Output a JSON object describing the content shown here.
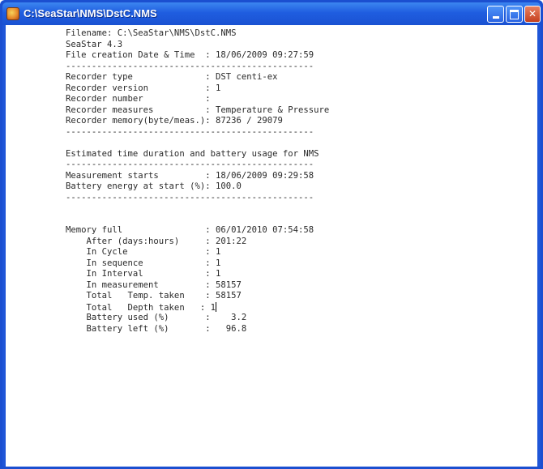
{
  "window": {
    "title": "C:\\SeaStar\\NMS\\DstC.NMS",
    "minimize_label": "",
    "maximize_label": "",
    "close_label": "✕"
  },
  "document": {
    "lines": [
      "Filename: C:\\SeaStar\\NMS\\DstC.NMS",
      "SeaStar 4.3",
      "File creation Date & Time  : 18/06/2009 09:27:59",
      "------------------------------------------------",
      "Recorder type              : DST centi-ex",
      "Recorder version           : 1",
      "Recorder number            :",
      "Recorder measures          : Temperature & Pressure",
      "Recorder memory(byte/meas.): 87236 / 29079",
      "------------------------------------------------",
      "",
      "Estimated time duration and battery usage for NMS",
      "------------------------------------------------",
      "Measurement starts         : 18/06/2009 09:29:58",
      "Battery energy at start (%): 100.0",
      "------------------------------------------------",
      "",
      "",
      "Memory full                : 06/01/2010 07:54:58",
      "    After (days:hours)     : 201:22",
      "    In Cycle               : 1",
      "    In sequence            : 1",
      "    In Interval            : 1",
      "    In measurement         : 58157",
      "    Total   Temp. taken    : 58157",
      "    Total   Depth taken   : 1",
      "    Battery used (%)       :    3.2",
      "    Battery left (%)       :   96.8"
    ]
  }
}
